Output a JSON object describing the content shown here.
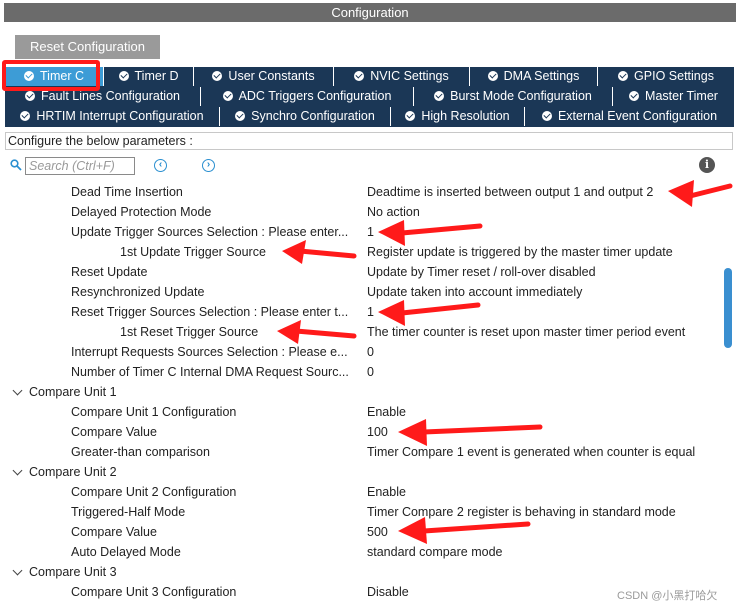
{
  "window": {
    "title": "Configuration"
  },
  "reset_button": {
    "label": "Reset Configuration"
  },
  "tabs": {
    "row1": [
      {
        "label": "Timer C",
        "active": true
      },
      {
        "label": "Timer D"
      },
      {
        "label": "User Constants"
      },
      {
        "label": "NVIC Settings"
      },
      {
        "label": "DMA Settings"
      },
      {
        "label": "GPIO Settings"
      }
    ],
    "row2": [
      {
        "label": "Fault Lines Configuration"
      },
      {
        "label": "ADC Triggers Configuration"
      },
      {
        "label": "Burst Mode Configuration"
      },
      {
        "label": "Master Timer"
      }
    ],
    "row3": [
      {
        "label": "HRTIM Interrupt Configuration"
      },
      {
        "label": "Synchro Configuration"
      },
      {
        "label": "High Resolution"
      },
      {
        "label": "External Event Configuration"
      }
    ]
  },
  "hint": "Configure the below parameters :",
  "search": {
    "placeholder": "Search (Ctrl+F)",
    "prev_icon": "arrow-left-circle-icon",
    "next_icon": "arrow-right-circle-icon"
  },
  "params": [
    {
      "label": "Dead Time Insertion",
      "value": "Deadtime is inserted between output 1 and output 2"
    },
    {
      "label": "Delayed Protection Mode",
      "value": "No action"
    },
    {
      "label": "Update Trigger Sources Selection : Please enter...",
      "value": "1"
    },
    {
      "label": "1st Update Trigger Source",
      "value": "Register update is triggered by the master timer update"
    },
    {
      "label": "Reset Update",
      "value": "Update by Timer reset / roll-over disabled"
    },
    {
      "label": "Resynchronized Update",
      "value": "Update taken into account immediately"
    },
    {
      "label": "Reset Trigger Sources Selection : Please enter t...",
      "value": "1"
    },
    {
      "label": "1st Reset Trigger Source",
      "value": "The timer counter is reset upon master timer period event"
    },
    {
      "label": "Interrupt Requests Sources Selection : Please e...",
      "value": "0"
    },
    {
      "label": "Number of Timer C Internal DMA Request Sourc...",
      "value": "0"
    },
    {
      "label": "Compare Unit 1",
      "value": ""
    },
    {
      "label": "Compare Unit 1 Configuration",
      "value": "Enable"
    },
    {
      "label": "Compare Value",
      "value": "100"
    },
    {
      "label": "Greater-than comparison",
      "value": "Timer Compare 1 event is generated when counter is equal"
    },
    {
      "label": "Compare Unit 2",
      "value": ""
    },
    {
      "label": "Compare Unit 2 Configuration",
      "value": "Enable"
    },
    {
      "label": "Triggered-Half Mode",
      "value": "Timer Compare 2 register is behaving in standard mode"
    },
    {
      "label": "Compare Value",
      "value": "500"
    },
    {
      "label": "Auto Delayed Mode",
      "value": "standard compare mode"
    },
    {
      "label": "Compare Unit 3",
      "value": ""
    },
    {
      "label": "Compare Unit 3 Configuration",
      "value": "Disable"
    }
  ],
  "watermark": "CSDN @小黑打哈欠",
  "colors": {
    "tab_bg": "#1b3756",
    "tab_active": "#3d9cd6",
    "annotation": "#ff1a1a",
    "title_bg": "#6b6b6b"
  }
}
